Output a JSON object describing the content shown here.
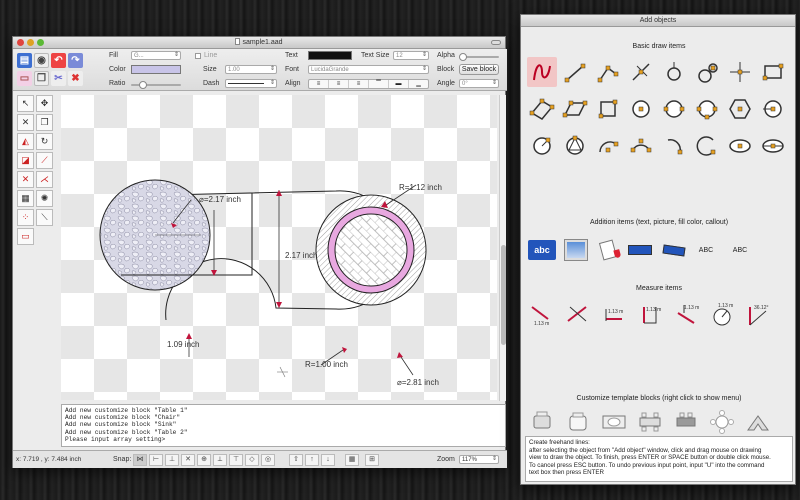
{
  "main_window": {
    "title": "sample1.aad",
    "props": {
      "fill_label": "Fill",
      "fill_select": "G...",
      "line_checkbox": "Line",
      "color_label": "Color",
      "color_swatch": "#c8c4e8",
      "size_label": "Size",
      "size_value": "1.00",
      "ratio_label": "Ratio",
      "dash_label": "Dash",
      "text_label": "Text",
      "text_color": "#111111",
      "text_size_label": "Text Size",
      "text_size_value": "12",
      "font_label": "Font",
      "font_value": "LucidaGrande",
      "align_label": "Align",
      "alpha_label": "Alpha",
      "block_label": "Block",
      "save_block_btn": "Save block",
      "angle_label": "Angle",
      "angle_value": "0°"
    },
    "drawing": {
      "dim_left_diameter": "⌀=2.17 inch",
      "dim_right_radius": "R=1.12 inch",
      "dim_center_height": "2.17 inch",
      "dim_bottom_left": "1.09 inch",
      "dim_bottom_radius": "R=1.00 inch",
      "dim_right_diameter": "⌀=2.81 inch"
    },
    "console_lines": [
      "Add new customize block \"Table 1\"",
      "Add new customize block \"Chair\"",
      "Add new customize block \"Sink\"",
      "Add new customize block \"Table 2\"",
      "Please input array setting>"
    ],
    "status": {
      "coords": "x: 7.719 , y: 7.484 inch",
      "snap_label": "Snap:",
      "zoom_label": "Zoom",
      "zoom_value": "117%"
    }
  },
  "panel": {
    "title": "Add objects",
    "section_basic": "Basic draw items",
    "section_addition": "Addition items (text, picture, fill color, callout)",
    "section_measure": "Measure items",
    "section_template": "Customize template blocks (right click to show menu)",
    "addition_abc_button": "abc",
    "addition_abc_text1": "ABC",
    "addition_abc_text2": "ABC",
    "measure_values": [
      "1.13 m",
      "1.13 m",
      "1.13 m",
      "1.13 m",
      "1.13 m",
      "36.12°"
    ],
    "info_lines": [
      "Create freehand lines:",
      "after selecting the object from \"Add object\" window, click and drag mouse on drawing",
      "view to draw the object. To finish, press ENTER or SPACE button or double click mouse.",
      "To cancel press ESC button. To undo previous input point, input \"U\" into the command",
      "text box then press ENTER"
    ]
  },
  "colors": {
    "accent": "#c0143c",
    "highlight": "#f2c6c6",
    "fill_pink": "#e8a8e0",
    "blue_button": "#2255bb"
  }
}
